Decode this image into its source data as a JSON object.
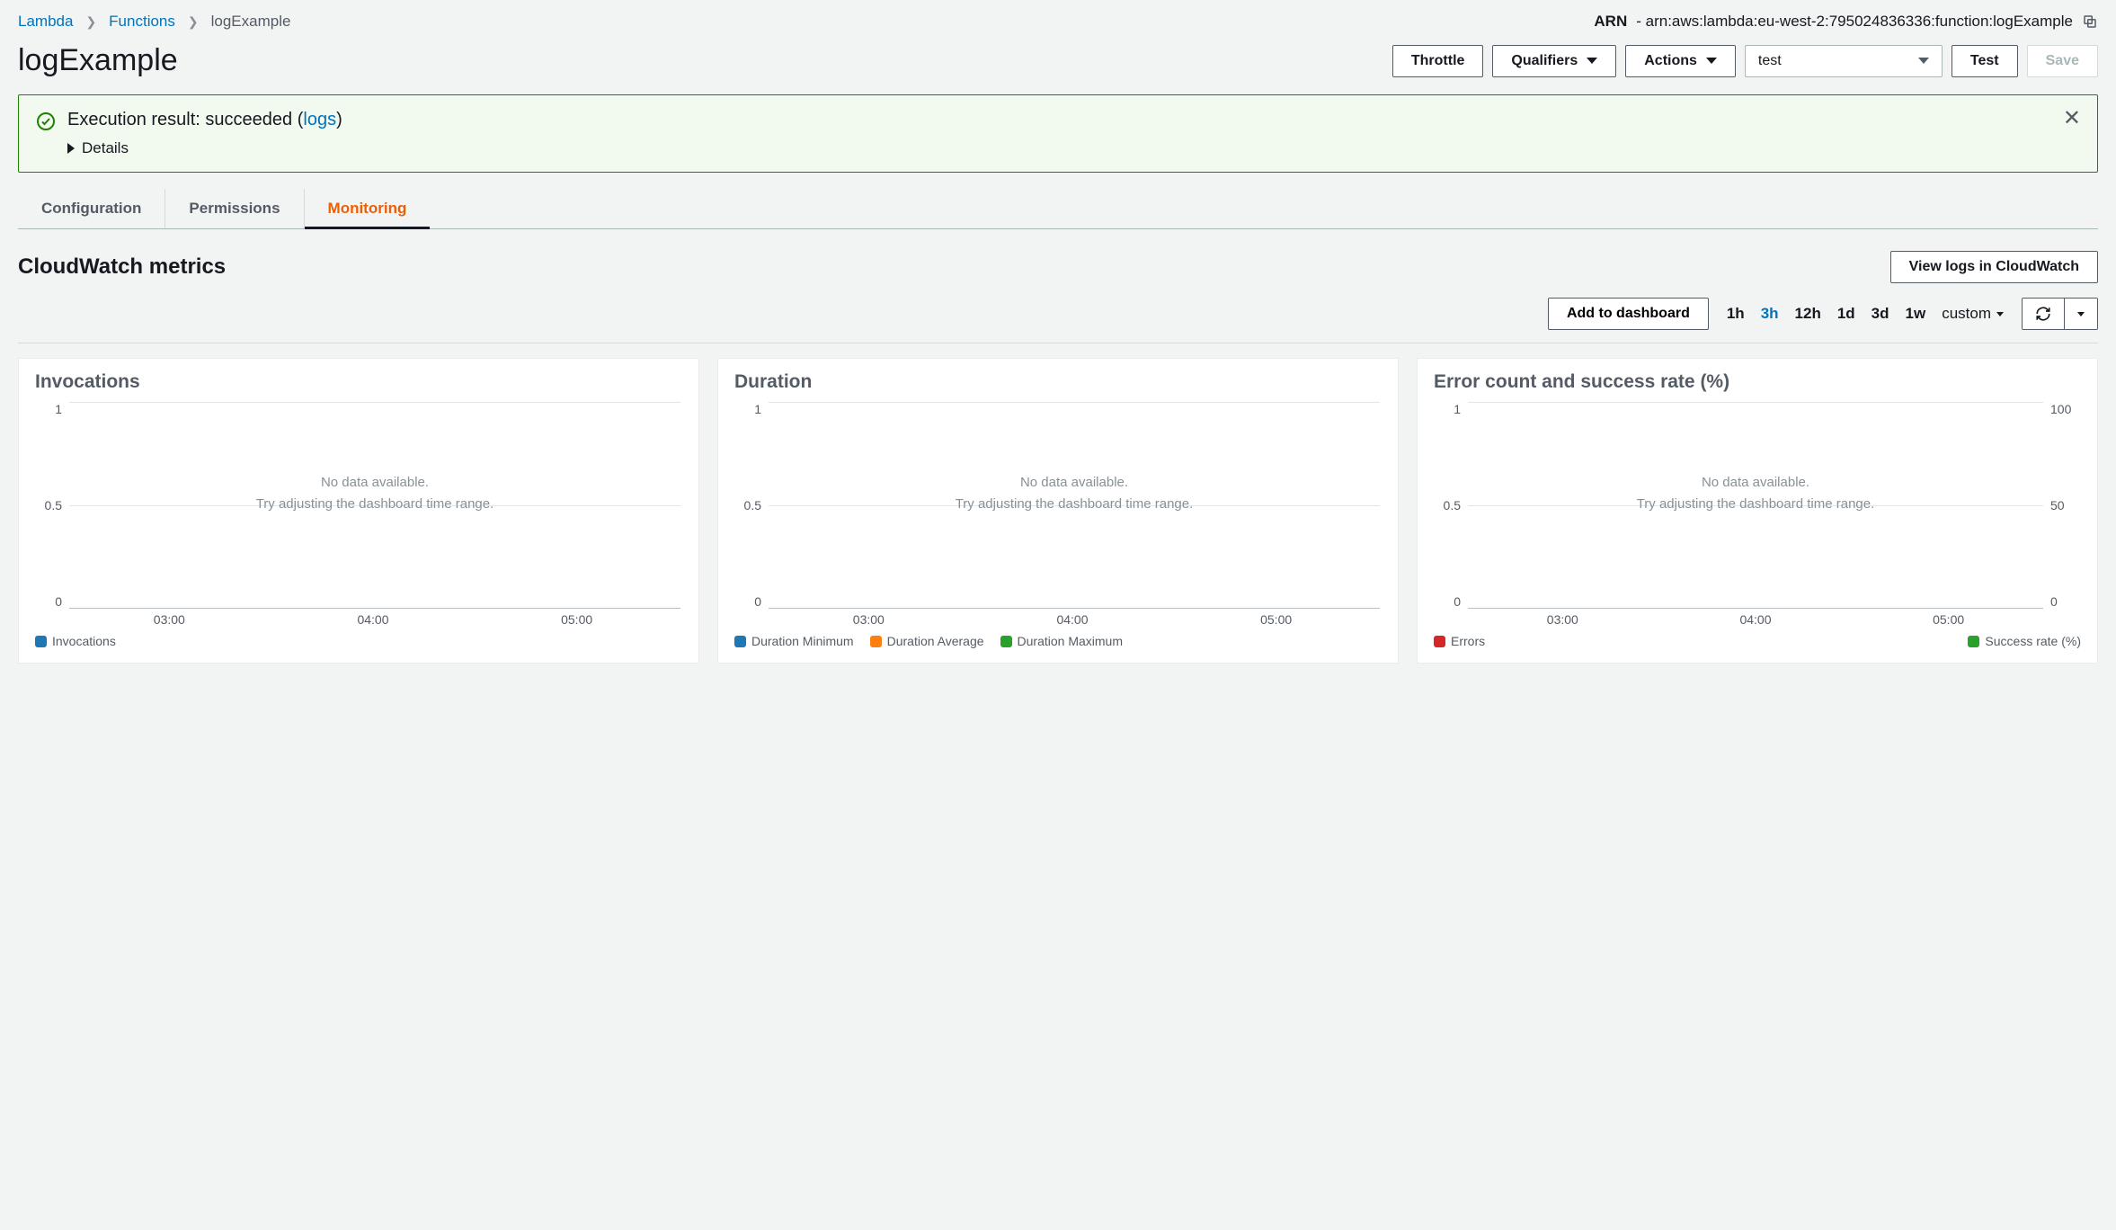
{
  "breadcrumb": {
    "root": "Lambda",
    "functions": "Functions",
    "current": "logExample"
  },
  "arn": {
    "label": "ARN",
    "dash": " - ",
    "value": "arn:aws:lambda:eu-west-2:795024836336:function:logExample"
  },
  "page_title": "logExample",
  "actions": {
    "throttle": "Throttle",
    "qualifiers": "Qualifiers",
    "actions": "Actions",
    "test_select": "test",
    "test": "Test",
    "save": "Save"
  },
  "alert": {
    "prefix": "Execution result: succeeded (",
    "logs_link": "logs",
    "suffix": ")",
    "details": "Details"
  },
  "tabs": {
    "configuration": "Configuration",
    "permissions": "Permissions",
    "monitoring": "Monitoring"
  },
  "metrics": {
    "title": "CloudWatch metrics",
    "view_logs": "View logs in CloudWatch",
    "add_dash": "Add to dashboard",
    "ranges": {
      "h1": "1h",
      "h3": "3h",
      "h12": "12h",
      "d1": "1d",
      "d3": "3d",
      "w1": "1w",
      "custom": "custom"
    }
  },
  "no_data": {
    "line1": "No data available.",
    "line2": "Try adjusting the dashboard time range."
  },
  "colors": {
    "blue": "#1f77b4",
    "orange": "#ff7f0e",
    "green": "#2ca02c",
    "red": "#d62728"
  },
  "chart_data": [
    {
      "type": "line",
      "title": "Invocations",
      "y_ticks_left": [
        "1",
        "0.5",
        "0"
      ],
      "x_ticks": [
        "03:00",
        "04:00",
        "05:00"
      ],
      "series": [
        {
          "name": "Invocations",
          "color_key": "blue",
          "values": []
        }
      ],
      "empty": true
    },
    {
      "type": "line",
      "title": "Duration",
      "y_ticks_left": [
        "1",
        "0.5",
        "0"
      ],
      "x_ticks": [
        "03:00",
        "04:00",
        "05:00"
      ],
      "series": [
        {
          "name": "Duration Minimum",
          "color_key": "blue",
          "values": []
        },
        {
          "name": "Duration Average",
          "color_key": "orange",
          "values": []
        },
        {
          "name": "Duration Maximum",
          "color_key": "green",
          "values": []
        }
      ],
      "empty": true
    },
    {
      "type": "line",
      "title": "Error count and success rate (%)",
      "y_ticks_left": [
        "1",
        "0.5",
        "0"
      ],
      "y_ticks_right": [
        "100",
        "50",
        "0"
      ],
      "x_ticks": [
        "03:00",
        "04:00",
        "05:00"
      ],
      "series": [
        {
          "name": "Errors",
          "color_key": "red",
          "values": []
        },
        {
          "name": "Success rate (%)",
          "color_key": "green",
          "values": []
        }
      ],
      "empty": true,
      "legend_split": true
    }
  ]
}
